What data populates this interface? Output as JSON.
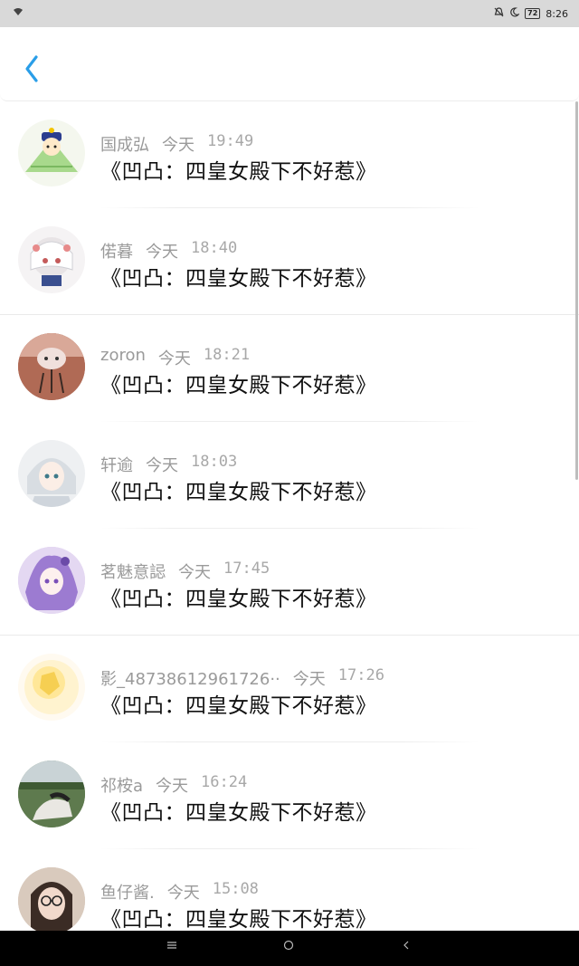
{
  "status_bar": {
    "time": "8:26",
    "battery": "72"
  },
  "header": {
    "back_icon": "chevron-left-icon",
    "accent": "#2a9ee8"
  },
  "rows": [
    {
      "name": "国成弘",
      "day": "今天",
      "time": "19:49",
      "message": "《凹凸：四皇女殿下不好惹》",
      "avatar": "avatar-green-zongzi"
    },
    {
      "name": "偌暮",
      "day": "今天",
      "time": "18:40",
      "message": "《凹凸：四皇女殿下不好惹》",
      "avatar": "avatar-white-hair-anime"
    },
    {
      "name": "zoron",
      "day": "今天",
      "time": "18:21",
      "message": "《凹凸：四皇女殿下不好惹》",
      "avatar": "avatar-plush-figure"
    },
    {
      "name": "轩逾",
      "day": "今天",
      "time": "18:03",
      "message": "《凹凸：四皇女殿下不好惹》",
      "avatar": "avatar-silver-hair-anime"
    },
    {
      "name": "茗魅意誋",
      "day": "今天",
      "time": "17:45",
      "message": "《凹凸：四皇女殿下不好惹》",
      "avatar": "avatar-purple-hair-anime"
    },
    {
      "name": "影_48738612961726··",
      "day": "今天",
      "time": "17:26",
      "message": "《凹凸：四皇女殿下不好惹》",
      "avatar": "avatar-yellow-blur"
    },
    {
      "name": "祁桉a",
      "day": "今天",
      "time": "16:24",
      "message": "《凹凸：四皇女殿下不好惹》",
      "avatar": "avatar-outdoor-photo"
    },
    {
      "name": "鱼仔酱.",
      "day": "今天",
      "time": "15:08",
      "message": "《凹凸：四皇女殿下不好惹》",
      "avatar": "avatar-girl-glasses"
    }
  ],
  "nav_bar": {
    "menu_icon": "menu-icon",
    "home_icon": "home-circle-icon",
    "back_icon": "back-triangle-icon"
  }
}
